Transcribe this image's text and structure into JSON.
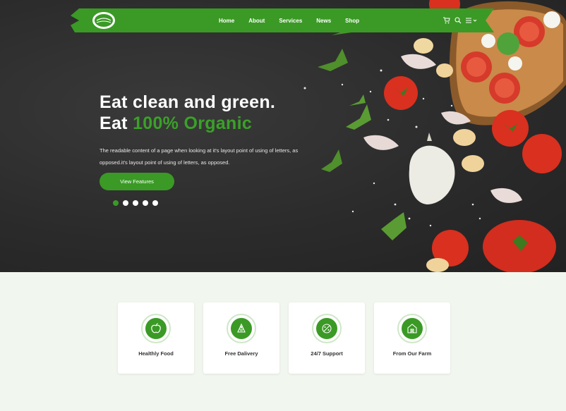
{
  "brand": {
    "logo_text": "100% Organic"
  },
  "nav": {
    "items": [
      {
        "label": "Home"
      },
      {
        "label": "About"
      },
      {
        "label": "Services"
      },
      {
        "label": "News"
      },
      {
        "label": "Shop"
      }
    ],
    "icons": [
      "cart-icon",
      "search-icon",
      "menu-icon"
    ]
  },
  "hero": {
    "headline_line1": "Eat clean and green.",
    "headline_line2_prefix": "Eat ",
    "headline_line2_highlight": "100% Organic",
    "description": "The readable content of a page when looking at it's layout point of using of letters, as opposed.it's layout point of using of letters, as opposed.",
    "cta_label": "View Features",
    "slides_count": 5,
    "active_slide": 1
  },
  "features": [
    {
      "label": "Healthly Food",
      "icon": "apple-icon"
    },
    {
      "label": "Free Dalivery",
      "icon": "delivery-icon"
    },
    {
      "label": "24/7 Support",
      "icon": "support-icon"
    },
    {
      "label": "From Our Farm",
      "icon": "farm-icon"
    }
  ],
  "colors": {
    "accent": "#3a9a25",
    "hero_bg": "#2b2b2b",
    "page_bg": "#f1f6ee"
  }
}
